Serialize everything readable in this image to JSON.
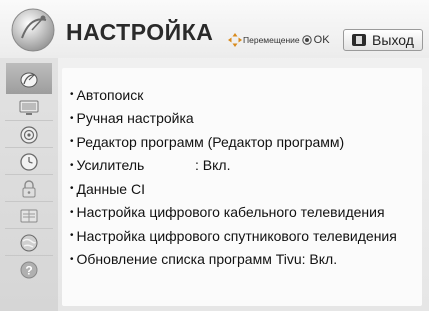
{
  "header": {
    "title": "НАСТРОЙКА",
    "nav_hint": "Перемещение",
    "ok_label": "OK",
    "exit_label": "Выход"
  },
  "sidebar": {
    "items": [
      {
        "icon": "satellite-dish-icon",
        "active": true
      },
      {
        "icon": "monitor-icon"
      },
      {
        "icon": "speaker-icon"
      },
      {
        "icon": "clock-icon"
      },
      {
        "icon": "lock-icon"
      },
      {
        "icon": "keyboard-icon"
      },
      {
        "icon": "globe-icon"
      },
      {
        "icon": "help-icon"
      }
    ]
  },
  "menu": {
    "items": [
      {
        "label": "Автопоиск"
      },
      {
        "label": "Ручная настройка"
      },
      {
        "label": "Редактор программ (Редактор программ)"
      },
      {
        "label": "Усилитель",
        "value": ": Вкл."
      },
      {
        "label": "Данные CI"
      },
      {
        "label": "Настройка цифрового кабельного телевидения"
      },
      {
        "label": "Настройка цифрового спутникового телевидения"
      },
      {
        "label": "Обновление списка программ Tivu: Вкл."
      }
    ]
  },
  "colors": {
    "background": "#f3f3f3",
    "panel": "#fbfbfb",
    "sidebar": "#dcdcdc",
    "sidebar_active": "#a8a8a8",
    "text": "#111111"
  }
}
